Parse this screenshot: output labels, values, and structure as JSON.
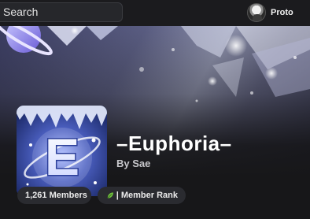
{
  "search": {
    "placeholder": "Search"
  },
  "user": {
    "name": "Proto",
    "avatar_icon": "user-avatar"
  },
  "server": {
    "name": "–Euphoria–",
    "owner": "By Sae",
    "icon_letter": "E",
    "members": "1,261 Members",
    "rank_icon": "leaf-icon",
    "rank_label": "| Member Rank"
  },
  "colors": {
    "background": "#1a1a1d",
    "chip_bg": "#2a2b30",
    "rank_green": "#6fbf3e",
    "icon_blue": "#3a4a8c"
  }
}
